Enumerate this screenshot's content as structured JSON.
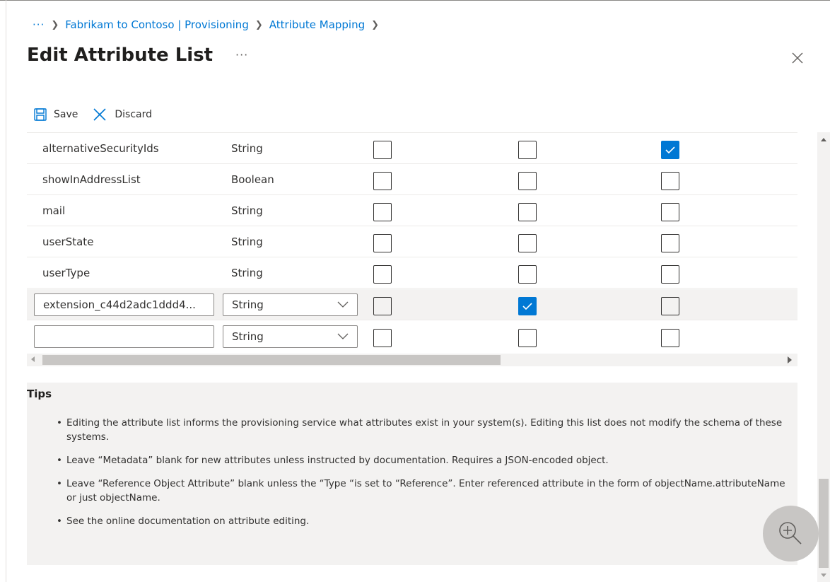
{
  "breadcrumb": {
    "ellipsis": "···",
    "items": [
      "Fabrikam to Contoso | Provisioning",
      "Attribute Mapping"
    ]
  },
  "page": {
    "title": "Edit Attribute List",
    "more": "···"
  },
  "toolbar": {
    "save_label": "Save",
    "discard_label": "Discard"
  },
  "rows": [
    {
      "name": "alternativeSecurityIds",
      "type": "String",
      "c1": false,
      "c2": false,
      "c3": true
    },
    {
      "name": "showInAddressList",
      "type": "Boolean",
      "c1": false,
      "c2": false,
      "c3": false
    },
    {
      "name": "mail",
      "type": "String",
      "c1": false,
      "c2": false,
      "c3": false
    },
    {
      "name": "userState",
      "type": "String",
      "c1": false,
      "c2": false,
      "c3": false
    },
    {
      "name": "userType",
      "type": "String",
      "c1": false,
      "c2": false,
      "c3": false
    }
  ],
  "edit_rows": [
    {
      "name_value": "extension_c44d2adc1ddd4...",
      "type_value": "String",
      "c1": false,
      "c2": true,
      "c3": false
    },
    {
      "name_value": "",
      "type_value": "String",
      "c1": false,
      "c2": false,
      "c3": false
    }
  ],
  "tips": {
    "title": "Tips",
    "items": [
      "Editing the attribute list informs the provisioning service what attributes exist in your system(s). Editing this list does not modify the schema of these systems.",
      "Leave “Metadata” blank for new attributes unless instructed by documentation. Requires a JSON-encoded object.",
      "Leave “Reference Object Attribute” blank unless the “Type “is set to “Reference”. Enter referenced attribute in the form of objectName.attributeName or just objectName.",
      "See the online documentation on attribute editing."
    ]
  },
  "colors": {
    "accent": "#0078d4",
    "selected_row": "#f3f2f1",
    "tips_bg": "#f3f2f1"
  },
  "icons": {
    "save": "save-icon",
    "discard": "close-icon",
    "close": "close-icon",
    "zoom": "zoom-in-icon"
  }
}
